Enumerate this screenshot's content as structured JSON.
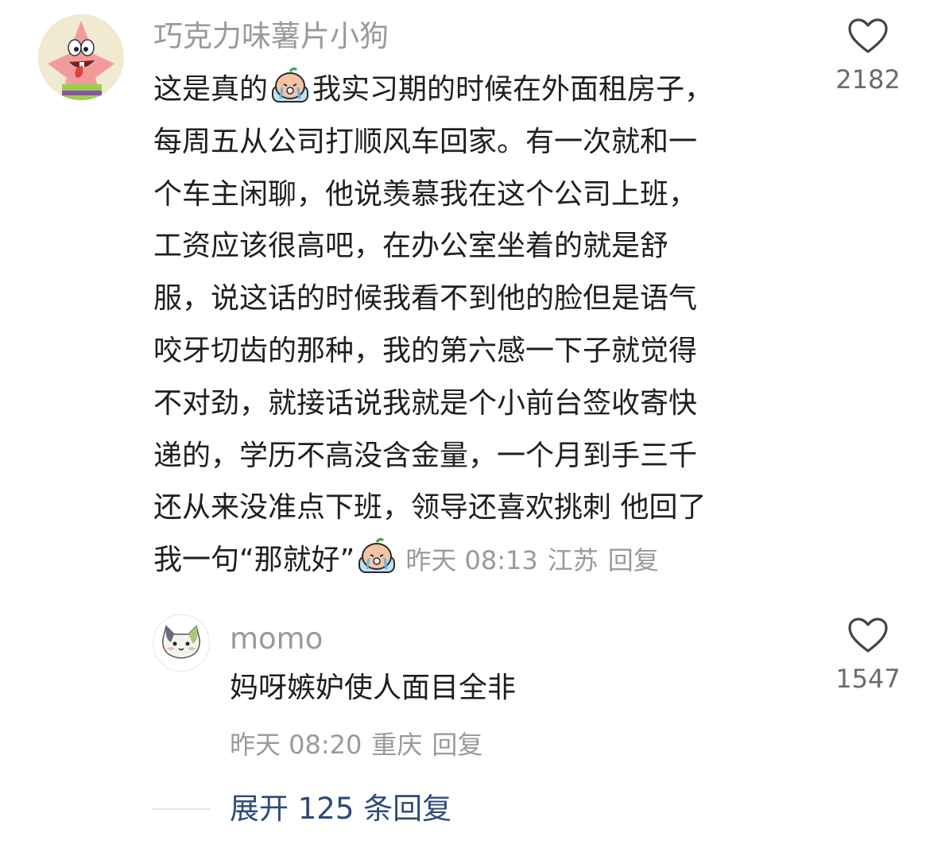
{
  "comment": {
    "username": "巧克力味薯片小狗",
    "avatar_icon": "patrick-star-avatar-icon",
    "lines": [
      {
        "before": "这是真的",
        "emoji": true,
        "after": "我实习期的时候在外面租房子，"
      },
      {
        "text": "每周五从公司打顺风车回家。有一次就和一"
      },
      {
        "text": "个车主闲聊，他说羡慕我在这个公司上班，"
      },
      {
        "text": "工资应该很高吧，在办公室坐着的就是舒"
      },
      {
        "text": "服，说这话的时候我看不到他的脸但是语气"
      },
      {
        "text": "咬牙切齿的那种，我的第六感一下子就觉得"
      },
      {
        "text": "不对劲，就接话说我就是个小前台签收寄快"
      },
      {
        "text": "递的，学历不高没含金量，一个月到手三千"
      },
      {
        "text": "还从来没准点下班，领导还喜欢挑刺 他回了"
      }
    ],
    "last_line": "我一句“那就好”",
    "emoji_icon": "crying-face-emoji-icon",
    "time": "昨天 08:13",
    "location": "江苏",
    "reply_label": "回复",
    "like_icon": "heart-icon",
    "likes": "2182"
  },
  "reply": {
    "username": "momo",
    "avatar_icon": "cat-avatar-icon",
    "text": "妈呀嫉妒使人面目全非",
    "time": "昨天 08:20",
    "location": "重庆",
    "reply_label": "回复",
    "like_icon": "heart-icon",
    "likes": "1547"
  },
  "expand": {
    "label": "展开 125 条回复"
  },
  "colors": {
    "username": "#9a9a9a",
    "text": "#1f1f1f",
    "link": "#2e4b7a",
    "meta": "#9a9a9a"
  }
}
